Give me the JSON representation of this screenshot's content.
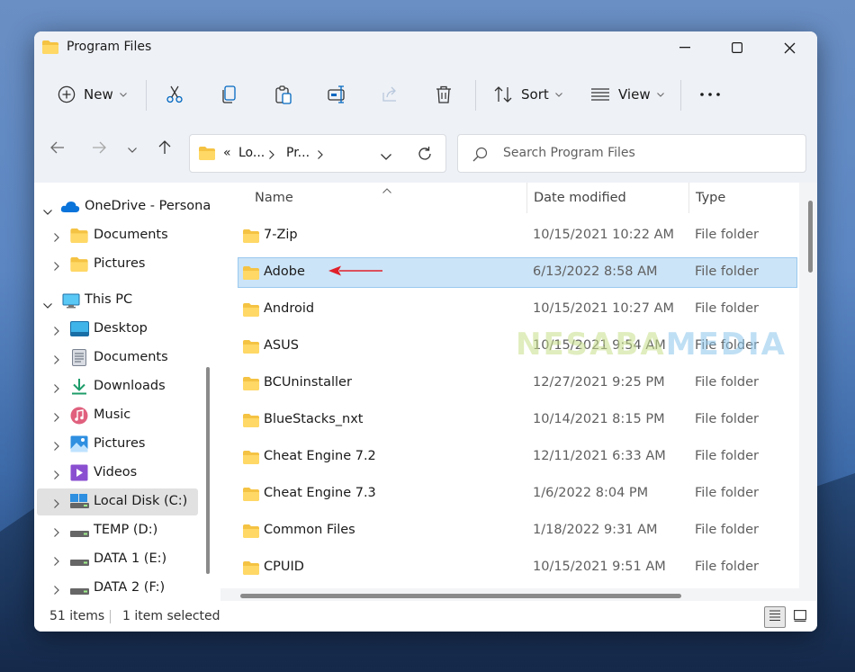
{
  "window": {
    "title": "Program Files"
  },
  "toolbar": {
    "new_label": "New",
    "sort_label": "Sort",
    "view_label": "View"
  },
  "address": {
    "crumbs": [
      "Lo...",
      "Pr..."
    ],
    "prefix": "«"
  },
  "search": {
    "placeholder": "Search Program Files"
  },
  "sidebar": {
    "items": [
      {
        "label": "OneDrive - Persona",
        "icon": "cloud-icon"
      },
      {
        "label": "Documents",
        "icon": "folder-icon"
      },
      {
        "label": "Pictures",
        "icon": "folder-icon"
      },
      {
        "label": "This PC",
        "icon": "monitor-icon"
      },
      {
        "label": "Desktop",
        "icon": "desktop-icon"
      },
      {
        "label": "Documents",
        "icon": "documents-icon"
      },
      {
        "label": "Downloads",
        "icon": "download-icon"
      },
      {
        "label": "Music",
        "icon": "music-icon"
      },
      {
        "label": "Pictures",
        "icon": "pictures-icon"
      },
      {
        "label": "Videos",
        "icon": "videos-icon"
      },
      {
        "label": "Local Disk (C:)",
        "icon": "drive-icon"
      },
      {
        "label": "TEMP (D:)",
        "icon": "drive-icon"
      },
      {
        "label": "DATA 1 (E:)",
        "icon": "drive-icon"
      },
      {
        "label": "DATA 2 (F:)",
        "icon": "drive-icon"
      }
    ]
  },
  "columns": {
    "name": "Name",
    "date": "Date modified",
    "type": "Type"
  },
  "files": [
    {
      "name": "7-Zip",
      "date": "10/15/2021 10:22 AM",
      "type": "File folder"
    },
    {
      "name": "Adobe",
      "date": "6/13/2022 8:58 AM",
      "type": "File folder"
    },
    {
      "name": "Android",
      "date": "10/15/2021 10:27 AM",
      "type": "File folder"
    },
    {
      "name": "ASUS",
      "date": "10/15/2021 9:54 AM",
      "type": "File folder"
    },
    {
      "name": "BCUninstaller",
      "date": "12/27/2021 9:25 PM",
      "type": "File folder"
    },
    {
      "name": "BlueStacks_nxt",
      "date": "10/14/2021 8:15 PM",
      "type": "File folder"
    },
    {
      "name": "Cheat Engine 7.2",
      "date": "12/11/2021 6:33 AM",
      "type": "File folder"
    },
    {
      "name": "Cheat Engine 7.3",
      "date": "1/6/2022 8:04 PM",
      "type": "File folder"
    },
    {
      "name": "Common Files",
      "date": "1/18/2022 9:31 AM",
      "type": "File folder"
    },
    {
      "name": "CPUID",
      "date": "10/15/2021 9:51 AM",
      "type": "File folder"
    }
  ],
  "watermark": {
    "part1": "NESABA",
    "part2": "MEDIA"
  },
  "status": {
    "count": "51 items",
    "selection": "1 item selected"
  },
  "colors": {
    "selection": "#cce4f7",
    "accent": "#0067c0",
    "arrow": "#e0202a",
    "folder": "#f5c343"
  }
}
